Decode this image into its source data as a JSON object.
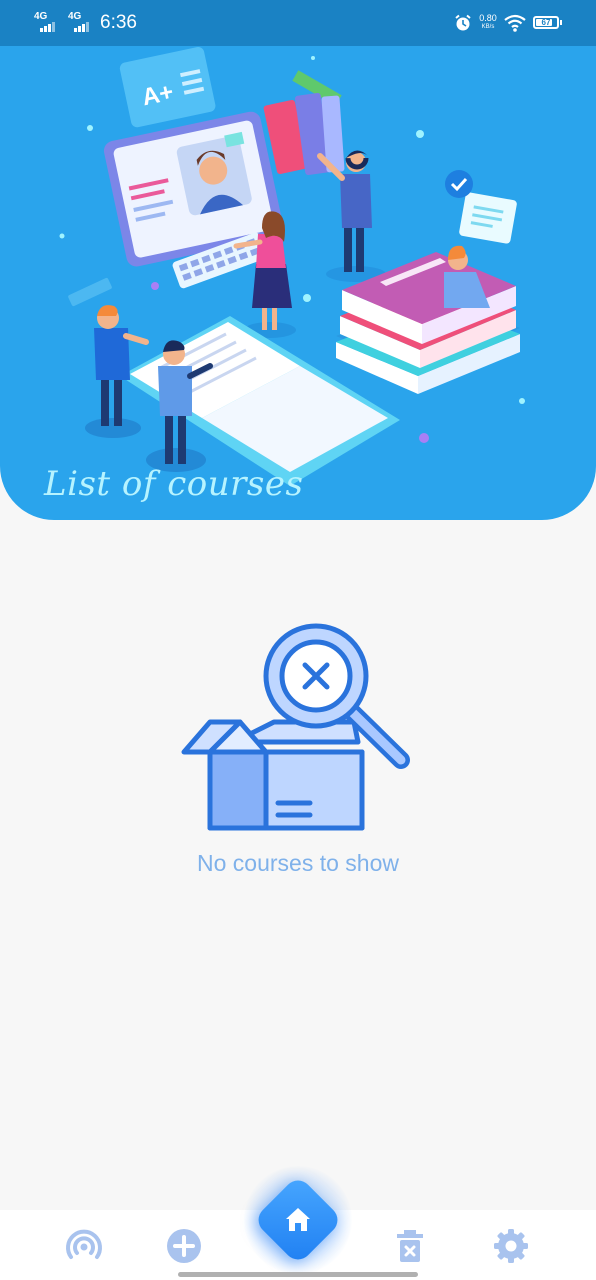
{
  "status_bar": {
    "network_1": "4G",
    "network_2": "4G",
    "time": "6:36",
    "speed_value": "0.80",
    "speed_unit": "KB/s",
    "battery": "67",
    "icons": [
      "signal-icon",
      "signal-icon",
      "alarm-icon",
      "wifi-icon",
      "battery-icon"
    ]
  },
  "hero": {
    "title": "List of courses",
    "badge": "A+",
    "illustration": "online-education-illustration"
  },
  "empty_state": {
    "message": "No courses to show",
    "icon": "empty-box-search-icon"
  },
  "bottom_nav": {
    "items": [
      {
        "name": "broadcast",
        "icon": "broadcast-icon"
      },
      {
        "name": "add",
        "icon": "add-circle-icon"
      },
      {
        "name": "home",
        "icon": "home-icon"
      },
      {
        "name": "delete",
        "icon": "trash-icon"
      },
      {
        "name": "settings",
        "icon": "gear-icon"
      }
    ]
  },
  "colors": {
    "hero_bg": "#2aa4ec",
    "status_bar": "#1a82c4",
    "accent": "#1f7ff2",
    "empty_text": "#7fb1ea",
    "nav_icon": "#a9c3ee",
    "page_bg": "#f7f7f7"
  }
}
